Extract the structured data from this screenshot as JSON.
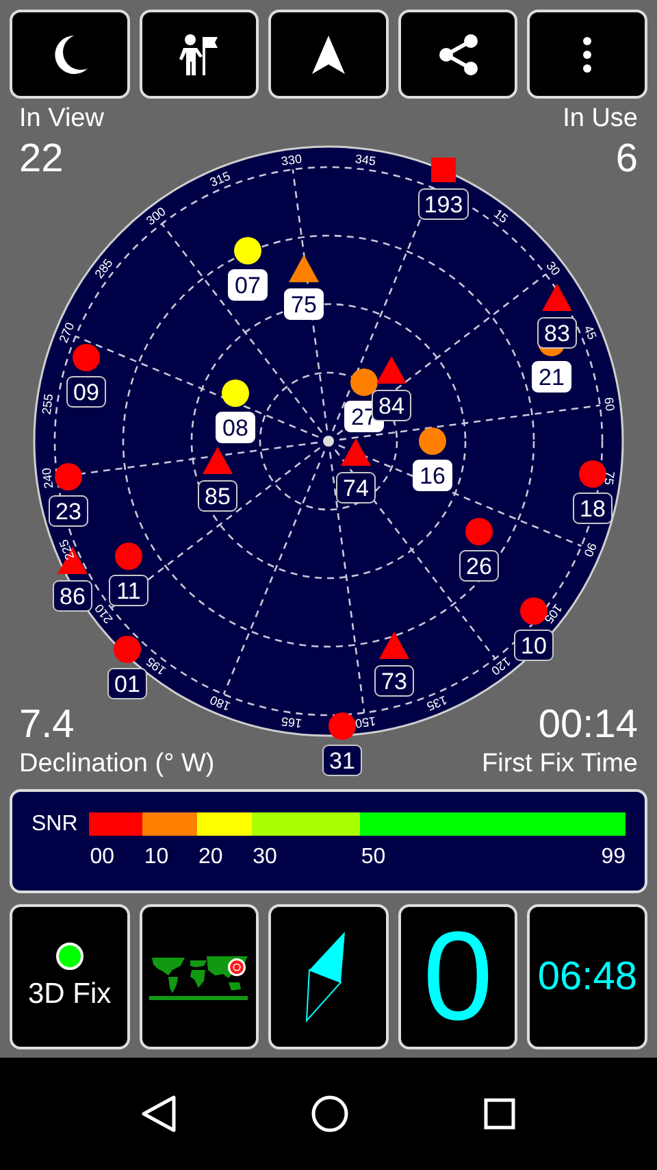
{
  "toolbar": [
    {
      "kind": "moon"
    },
    {
      "kind": "person-flag"
    },
    {
      "kind": "navigation"
    },
    {
      "kind": "share"
    },
    {
      "kind": "more"
    }
  ],
  "in_view": {
    "label": "In View",
    "value": "22"
  },
  "in_use": {
    "label": "In Use",
    "value": "6"
  },
  "declination": {
    "value": "7.4",
    "label": "Declination (° W)"
  },
  "first_fix": {
    "value": "00:14",
    "label": "First Fix Time"
  },
  "sky_plot": {
    "bearing_labels": [
      "15",
      "30",
      "45",
      "60",
      "75",
      "90",
      "105",
      "120",
      "135",
      "150",
      "165",
      "180",
      "195",
      "210",
      "225",
      "240",
      "255",
      "270",
      "285",
      "300",
      "315",
      "330",
      "345"
    ],
    "satellites": [
      {
        "id": "193",
        "kind": "square",
        "color": "#ff0000",
        "used": false
      },
      {
        "id": "07",
        "kind": "circle",
        "color": "#ffff00",
        "used": true
      },
      {
        "id": "75",
        "kind": "triangle",
        "color": "#ff8000",
        "used": true
      },
      {
        "id": "83",
        "kind": "triangle",
        "color": "#ff0000",
        "used": false
      },
      {
        "id": "21",
        "kind": "circle",
        "color": "#ff8000",
        "used": true
      },
      {
        "id": "09",
        "kind": "circle",
        "color": "#ff0000",
        "used": false
      },
      {
        "id": "08",
        "kind": "circle",
        "color": "#ffff00",
        "used": true
      },
      {
        "id": "27",
        "kind": "circle",
        "color": "#ff8000",
        "used": true
      },
      {
        "id": "84",
        "kind": "triangle",
        "color": "#ff0000",
        "used": false
      },
      {
        "id": "16",
        "kind": "circle",
        "color": "#ff8000",
        "used": true
      },
      {
        "id": "85",
        "kind": "triangle",
        "color": "#ff0000",
        "used": false
      },
      {
        "id": "74",
        "kind": "triangle",
        "color": "#ff0000",
        "used": false
      },
      {
        "id": "23",
        "kind": "circle",
        "color": "#ff0000",
        "used": false
      },
      {
        "id": "18",
        "kind": "circle",
        "color": "#ff0000",
        "used": false
      },
      {
        "id": "26",
        "kind": "circle",
        "color": "#ff0000",
        "used": false
      },
      {
        "id": "86",
        "kind": "triangle",
        "color": "#ff0000",
        "used": false
      },
      {
        "id": "11",
        "kind": "circle",
        "color": "#ff0000",
        "used": false
      },
      {
        "id": "10",
        "kind": "circle",
        "color": "#ff0000",
        "used": false
      },
      {
        "id": "73",
        "kind": "triangle",
        "color": "#ff0000",
        "used": false
      },
      {
        "id": "01",
        "kind": "circle",
        "color": "#ff0000",
        "used": false
      },
      {
        "id": "31",
        "kind": "circle",
        "color": "#ff0000",
        "used": false
      }
    ]
  },
  "snr": {
    "label": "SNR",
    "segments": [
      {
        "color": "#ff0000"
      },
      {
        "color": "#ff8000"
      },
      {
        "color": "#ffff00"
      },
      {
        "color": "#aaff00"
      },
      {
        "color": "#00ff00"
      }
    ],
    "ticks": [
      "00",
      "10",
      "20",
      "30",
      "50",
      "99"
    ]
  },
  "tiles": [
    {
      "kind": "fix",
      "label": "3D Fix",
      "color": "#00ff00"
    },
    {
      "kind": "map"
    },
    {
      "kind": "compass"
    },
    {
      "kind": "count",
      "value": "0"
    },
    {
      "kind": "time",
      "value": "06:48"
    }
  ],
  "nav": [
    {
      "kind": "back"
    },
    {
      "kind": "home"
    },
    {
      "kind": "recents"
    }
  ]
}
